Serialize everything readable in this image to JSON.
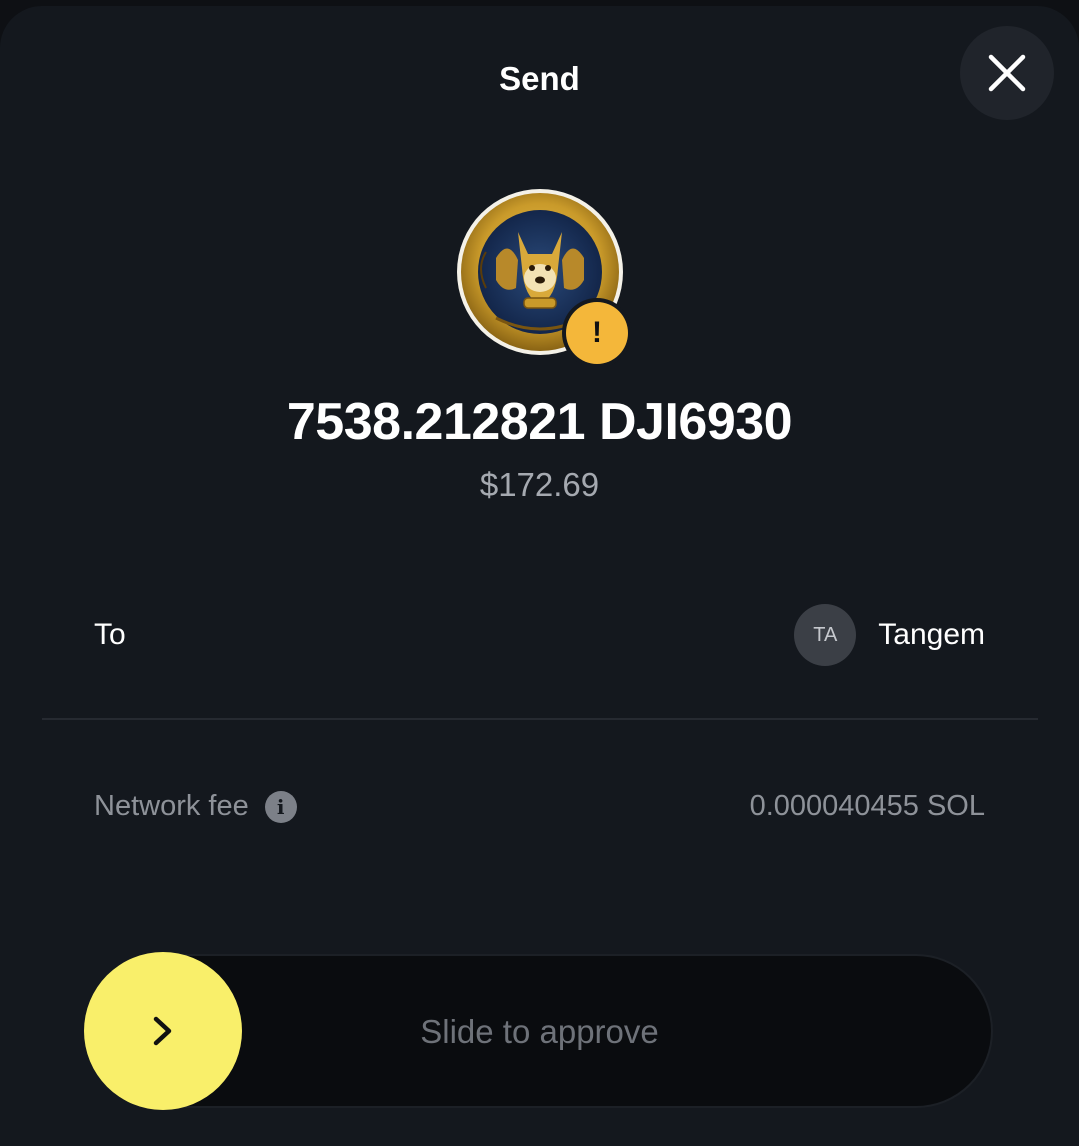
{
  "header": {
    "title": "Send",
    "close_icon": "close-icon"
  },
  "token": {
    "icon": "dowgi-coin-icon",
    "warning_badge": "!",
    "amount": "7538.212821 DJI6930",
    "fiat_value": "$172.69"
  },
  "recipient": {
    "label": "To",
    "avatar_initials": "TA",
    "name": "Tangem"
  },
  "fee": {
    "label": "Network fee",
    "value": "0.000040455 SOL",
    "info_icon": "info-icon"
  },
  "slider": {
    "label": "Slide to approve",
    "knob_icon": "chevron-right-icon"
  },
  "colors": {
    "accent": "#f9ef6a",
    "warning": "#f4b73a",
    "background": "#14181e"
  }
}
